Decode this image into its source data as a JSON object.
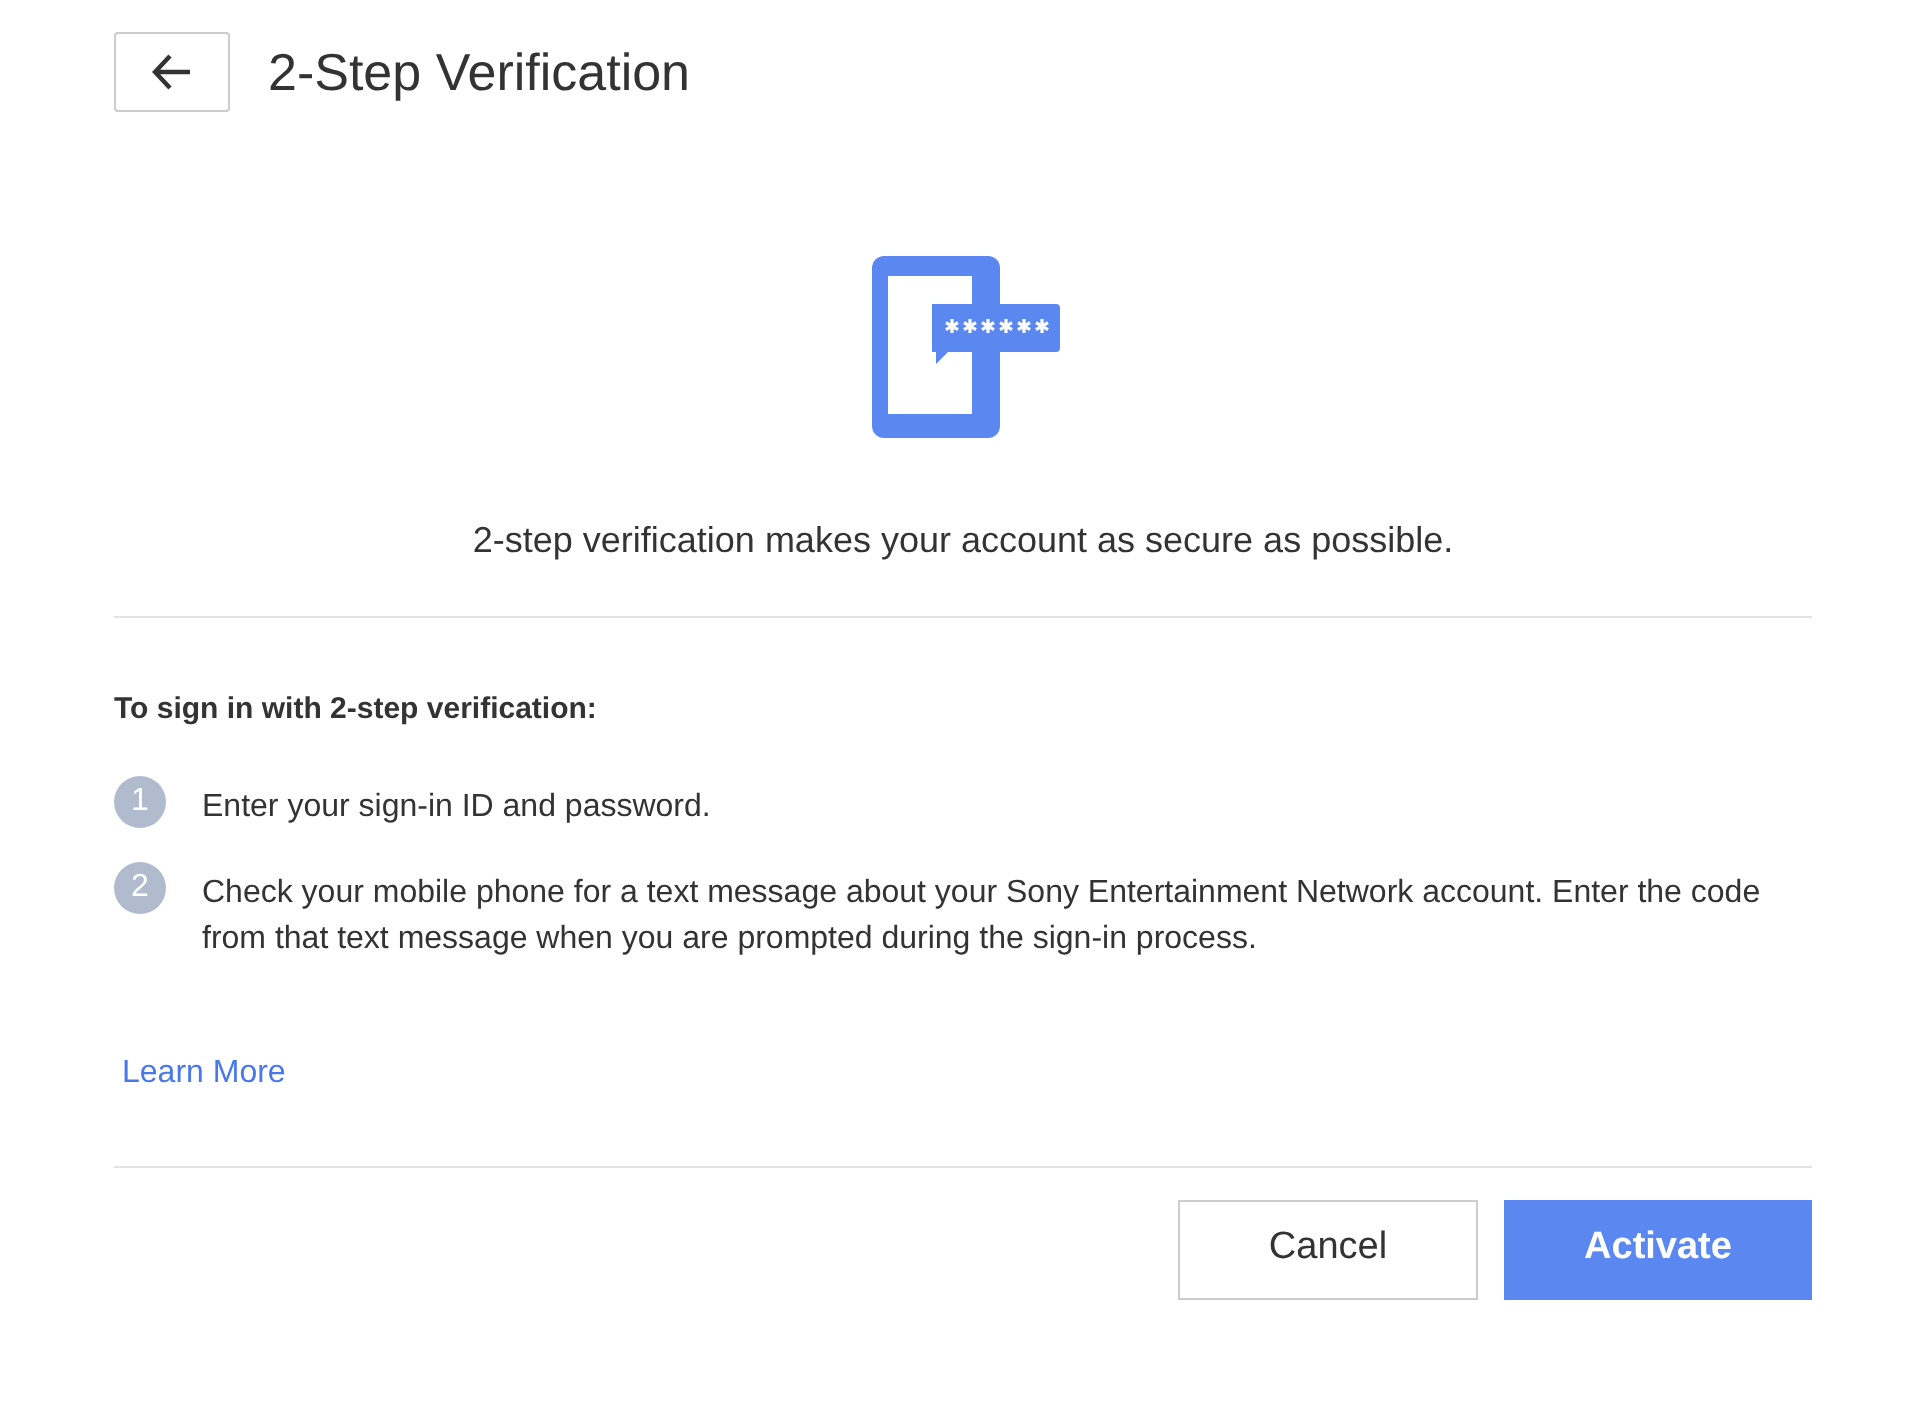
{
  "header": {
    "title": "2-Step Verification"
  },
  "intro": "2-step verification makes your account as secure as possible.",
  "steps_heading": "To sign in with 2-step verification:",
  "steps": [
    {
      "number": "1",
      "text": "Enter your sign-in ID and password."
    },
    {
      "number": "2",
      "text": "Check your mobile phone for a text message about your Sony Entertainment Network account. Enter the code from that text message when you are prompted during the sign-in process."
    }
  ],
  "learn_more": "Learn More",
  "buttons": [
    {
      "label": "Cancel",
      "kind": "secondary"
    },
    {
      "label": "Activate",
      "kind": "primary"
    }
  ]
}
